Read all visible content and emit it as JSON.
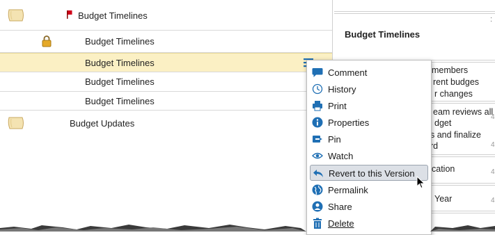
{
  "rows": [
    {
      "label": "Budget Timelines",
      "icon": "folder-icon"
    },
    {
      "label": "Budget Timelines",
      "icon": "lock-icon"
    },
    {
      "label": "Budget Timelines",
      "icon": "none",
      "selected": true
    },
    {
      "label": "Budget Timelines",
      "icon": "none"
    },
    {
      "label": "Budget Timelines",
      "icon": "none"
    },
    {
      "label": "Budget Updates",
      "icon": "folder-icon"
    }
  ],
  "right_panel": {
    "title": "Budget Timelines",
    "lines": [
      "members",
      "rent budges",
      "r changes",
      "eam reviews all",
      "dget",
      "s and finalize",
      "rd",
      "cation",
      "Year"
    ],
    "side_marks": [
      ":",
      "4",
      "4",
      "4",
      "4"
    ]
  },
  "context_menu": {
    "items": [
      {
        "label": "Comment",
        "icon": "comment-icon"
      },
      {
        "label": "History",
        "icon": "history-icon"
      },
      {
        "label": "Print",
        "icon": "print-icon"
      },
      {
        "label": "Properties",
        "icon": "info-icon"
      },
      {
        "label": "Pin",
        "icon": "pin-icon"
      },
      {
        "label": "Watch",
        "icon": "eye-icon"
      },
      {
        "label": "Revert to this Version",
        "icon": "revert-icon",
        "highlighted": true
      },
      {
        "label": "Permalink",
        "icon": "globe-icon"
      },
      {
        "label": "Share",
        "icon": "share-icon"
      },
      {
        "label": "Delete",
        "icon": "trash-icon"
      }
    ]
  },
  "colors": {
    "selected_row": "#fbf0c4",
    "menu_icon": "#1f6fb4",
    "flag": "#d0021b",
    "highlight": "#dce0e6"
  }
}
